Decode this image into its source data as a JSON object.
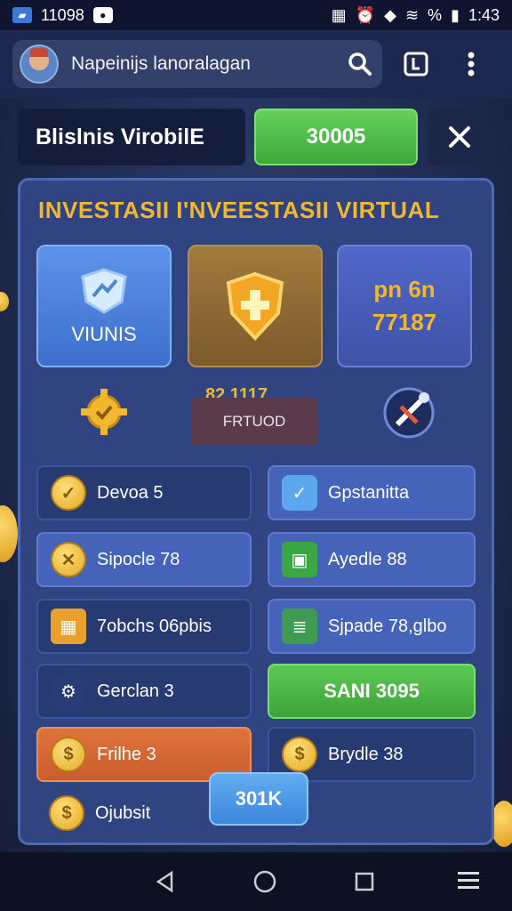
{
  "status_bar": {
    "time_left": "11098",
    "time_right": "1:43",
    "battery": "%"
  },
  "header": {
    "search_text": "Napeinijs lanoralagan"
  },
  "top": {
    "title": "Blislnis VirobilE",
    "amount_button": "30005"
  },
  "panel": {
    "title": "INVESTASII I'NVEESTASII VIRTUAL",
    "cards": [
      {
        "label": "VIUNIS"
      },
      {
        "label": ""
      },
      {
        "line1": "pn 6n",
        "line2": "77187"
      }
    ],
    "mid": {
      "value": "82.1117",
      "badge": "FRTUOD"
    },
    "rows": [
      {
        "left": "Devoa 5",
        "right": "Gpstanitta"
      },
      {
        "left": "Sipocle 78",
        "right": "Ayedle 88"
      },
      {
        "left": "7obchs 06pbis",
        "right": "Sjpade 78,glbo"
      },
      {
        "left": "Gerclan 3",
        "right": "SANI 3095"
      },
      {
        "left": "Frilhe 3",
        "right": "Brydle 38"
      },
      {
        "left": "Ojubsit"
      }
    ],
    "float_button": "301K"
  },
  "colors": {
    "accent_gold": "#f0b72f",
    "green": "#3ea83a",
    "orange": "#c95d2e"
  }
}
